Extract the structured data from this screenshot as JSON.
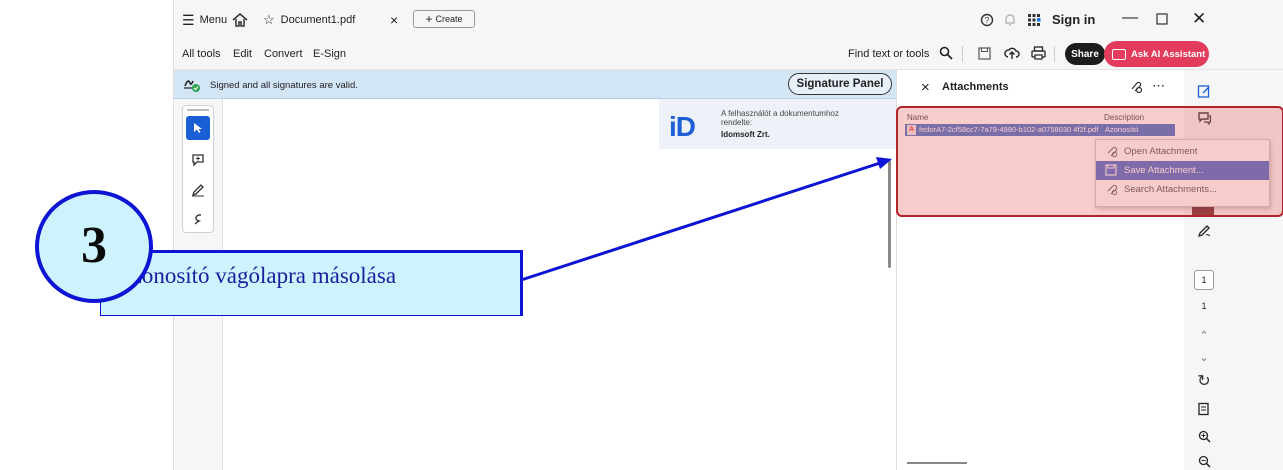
{
  "titlebar": {
    "menu_label": "Menu",
    "tab_title": "Document1.pdf",
    "create_label": "Create",
    "sign_in": "Sign in"
  },
  "toolbar": {
    "items": [
      "All tools",
      "Edit",
      "Convert",
      "E-Sign"
    ],
    "find_label": "Find text or tools",
    "share_label": "Share",
    "ai_label": "Ask AI Assistant"
  },
  "signature_bar": {
    "message": "Signed and all signatures are valid.",
    "panel_button": "Signature Panel"
  },
  "id_card": {
    "line1": "A felhasználót a dokumentumhoz",
    "line2": "rendelte:",
    "company": "Idomsoft Zrt."
  },
  "attachments": {
    "title": "Attachments",
    "col_name": "Name",
    "col_description": "Description",
    "file_name": "fedorA7-2cf58cc7-7a79-4990-b102-a0758030 4f2f.pdf",
    "file_desc": "Azonosító"
  },
  "context_menu": {
    "items": [
      "Open Attachment",
      "Save Attachment...",
      "Search Attachments..."
    ],
    "highlighted_index": 1
  },
  "page_nav": {
    "current_page": "1",
    "total_pages": "1"
  },
  "callout": {
    "number": "3",
    "text": "Azonosító vágólapra másolása"
  },
  "colors": {
    "accent_blue": "#0d14d4",
    "callout_fill": "#cdf4fd",
    "highlight_red": "#b2232c",
    "ai_button": "#e23b5b",
    "menu_highlight": "#3d63c8"
  }
}
